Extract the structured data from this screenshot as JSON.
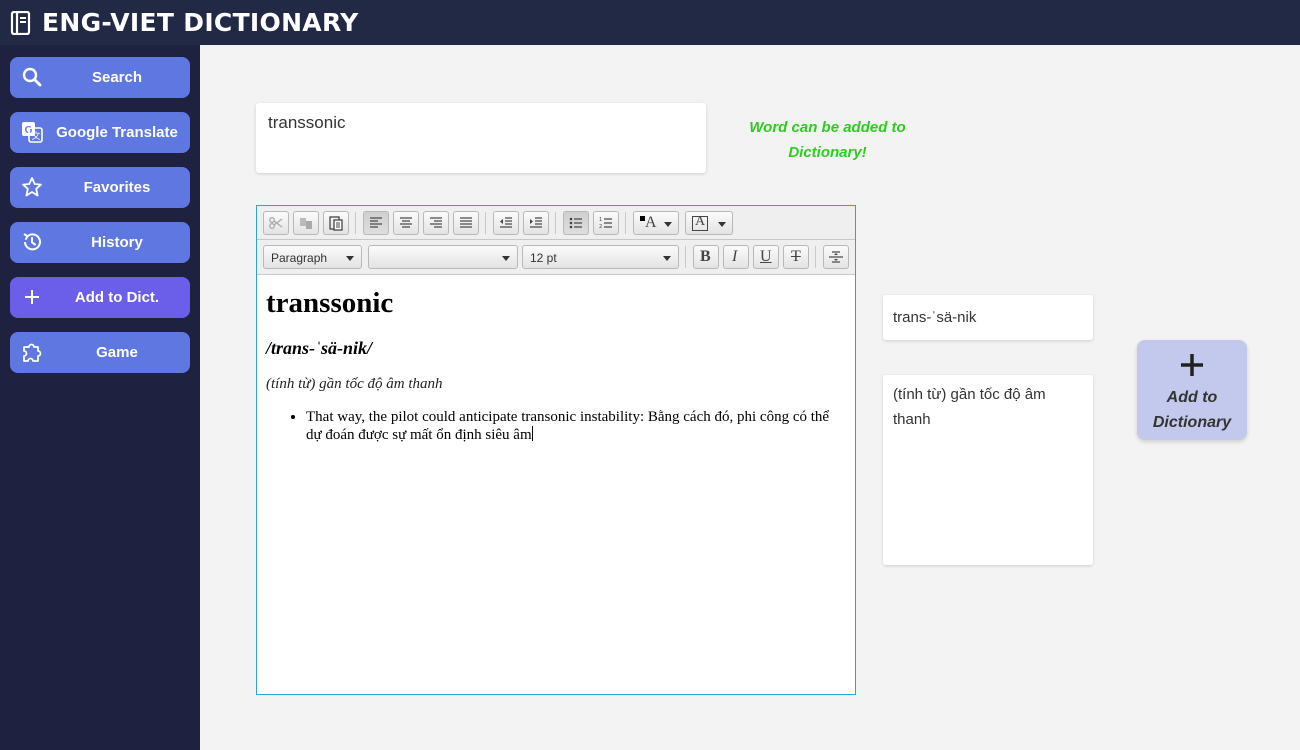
{
  "app": {
    "title": "ENG-VIET DICTIONARY"
  },
  "sidebar": {
    "items": [
      {
        "label": "Search",
        "icon": "search-icon"
      },
      {
        "label": "Google Translate",
        "icon": "translate-icon"
      },
      {
        "label": "Favorites",
        "icon": "star-icon"
      },
      {
        "label": "History",
        "icon": "history-icon"
      },
      {
        "label": "Add to Dict.",
        "icon": "plus-icon",
        "active": true
      },
      {
        "label": "Game",
        "icon": "puzzle-icon"
      }
    ]
  },
  "word_input": {
    "value": "transsonic"
  },
  "status": {
    "message": "Word can be added to Dictionary!",
    "color": "#2ecc1f"
  },
  "editor": {
    "paragraph_style": "Paragraph",
    "font_family": "",
    "font_size": "12 pt",
    "content": {
      "heading": "transsonic",
      "pronunciation": "/trans-ˈsä-nik/",
      "part_of_speech": "(tính từ) gần tốc độ âm thanh",
      "examples": [
        "That way, the pilot could anticipate transonic instability: Bằng cách đó, phi công có thể dự đoán được sự mất ổn định siêu âm"
      ]
    }
  },
  "pronunciation_field": {
    "value": "trans-ˈsä-nik"
  },
  "meaning_field": {
    "value": "(tính từ) gần tốc độ âm thanh"
  },
  "add_button": {
    "label": "Add to Dictionary"
  },
  "colors": {
    "topbar": "#222944",
    "sidebar": "#1e2140",
    "nav_button": "#5f77e0",
    "nav_button_active": "#6b5ee8",
    "add_button": "#c3c9ec",
    "editor_border": "#2aa3d8"
  }
}
